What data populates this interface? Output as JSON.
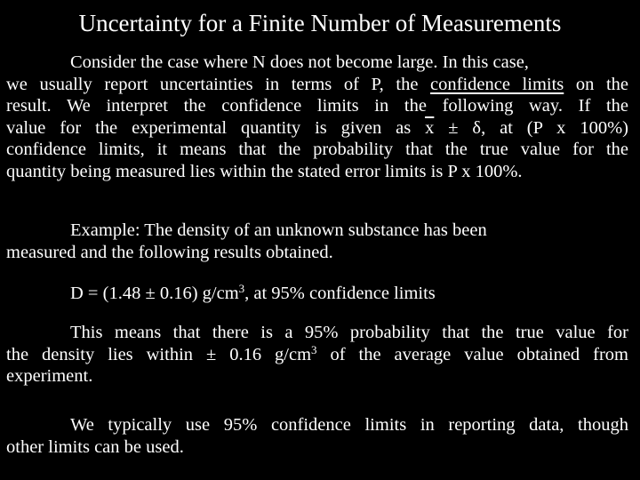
{
  "slide": {
    "title": "Uncertainty for a Finite Number of Measurements",
    "paragraph1": {
      "l1": "Consider the case where N does not become large.  In this case,",
      "l2_pre": "we usually report uncertainties in terms of P, the ",
      "l2_underlined": "confidence limits",
      "l2_post": " on the",
      "l3": "result.  We interpret the confidence limits in the following way.  If the",
      "l4_pre": "value for the experimental quantity is given as ",
      "l4_xbar": "x",
      "l4_post": " ± δ, at (P x 100%)",
      "l5": "confidence limits, it means that the probability that the true value for the",
      "l6": "quantity being measured lies within the stated error limits is P x 100%."
    },
    "paragraph2": {
      "l1": "Example: The density of an unknown substance has been",
      "l2": "measured and the following results obtained."
    },
    "equation": {
      "pre": "D = (1.48 ± 0.16) g/cm",
      "sup": "3",
      "post": ", at 95% confidence limits"
    },
    "paragraph3": {
      "l1": "This means that there is a 95% probability that the true value for",
      "l2_pre": "the density lies within ± 0.16 g/cm",
      "l2_sup": "3",
      "l2_post": " of the average value obtained from",
      "l3": "experiment."
    },
    "paragraph4": {
      "l1": "We typically use 95% confidence limits in reporting data, though",
      "l2": "other limits can be used."
    }
  }
}
